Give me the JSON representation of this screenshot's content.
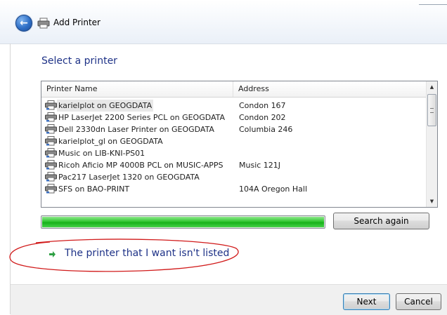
{
  "window": {
    "title": "Add Printer"
  },
  "heading": "Select a printer",
  "printer_list": {
    "columns": {
      "name": "Printer Name",
      "address": "Address"
    },
    "rows": [
      {
        "name": "karielplot on GEOGDATA",
        "address": "Condon 167",
        "selected": true
      },
      {
        "name": "HP LaserJet 2200 Series PCL on GEOGDATA",
        "address": "Condon 202"
      },
      {
        "name": "Dell 2330dn Laser Printer on GEOGDATA",
        "address": "Columbia 246"
      },
      {
        "name": "karielplot_gl on GEOGDATA",
        "address": ""
      },
      {
        "name": "Music on LIB-KNI-PS01",
        "address": ""
      },
      {
        "name": "Ricoh Aficio MP 4000B PCL on MUSIC-APPS",
        "address": "Music 121J"
      },
      {
        "name": "Pac217 LaserJet 1320 on GEOGDATA",
        "address": ""
      },
      {
        "name": "SFS on BAO-PRINT",
        "address": "104A Oregon Hall"
      }
    ]
  },
  "search_progress": 1.0,
  "buttons": {
    "search_again": "Search again",
    "next": "Next",
    "cancel": "Cancel"
  },
  "link": {
    "printer_not_listed": "The printer that I want isn't listed"
  },
  "icons": {
    "back": "back-arrow-icon",
    "printer": "printer-icon",
    "link_arrow": "green-arrow-icon"
  },
  "colors": {
    "heading": "#1e3287",
    "progress": "#16b11a",
    "annotation": "#d11a1a"
  }
}
